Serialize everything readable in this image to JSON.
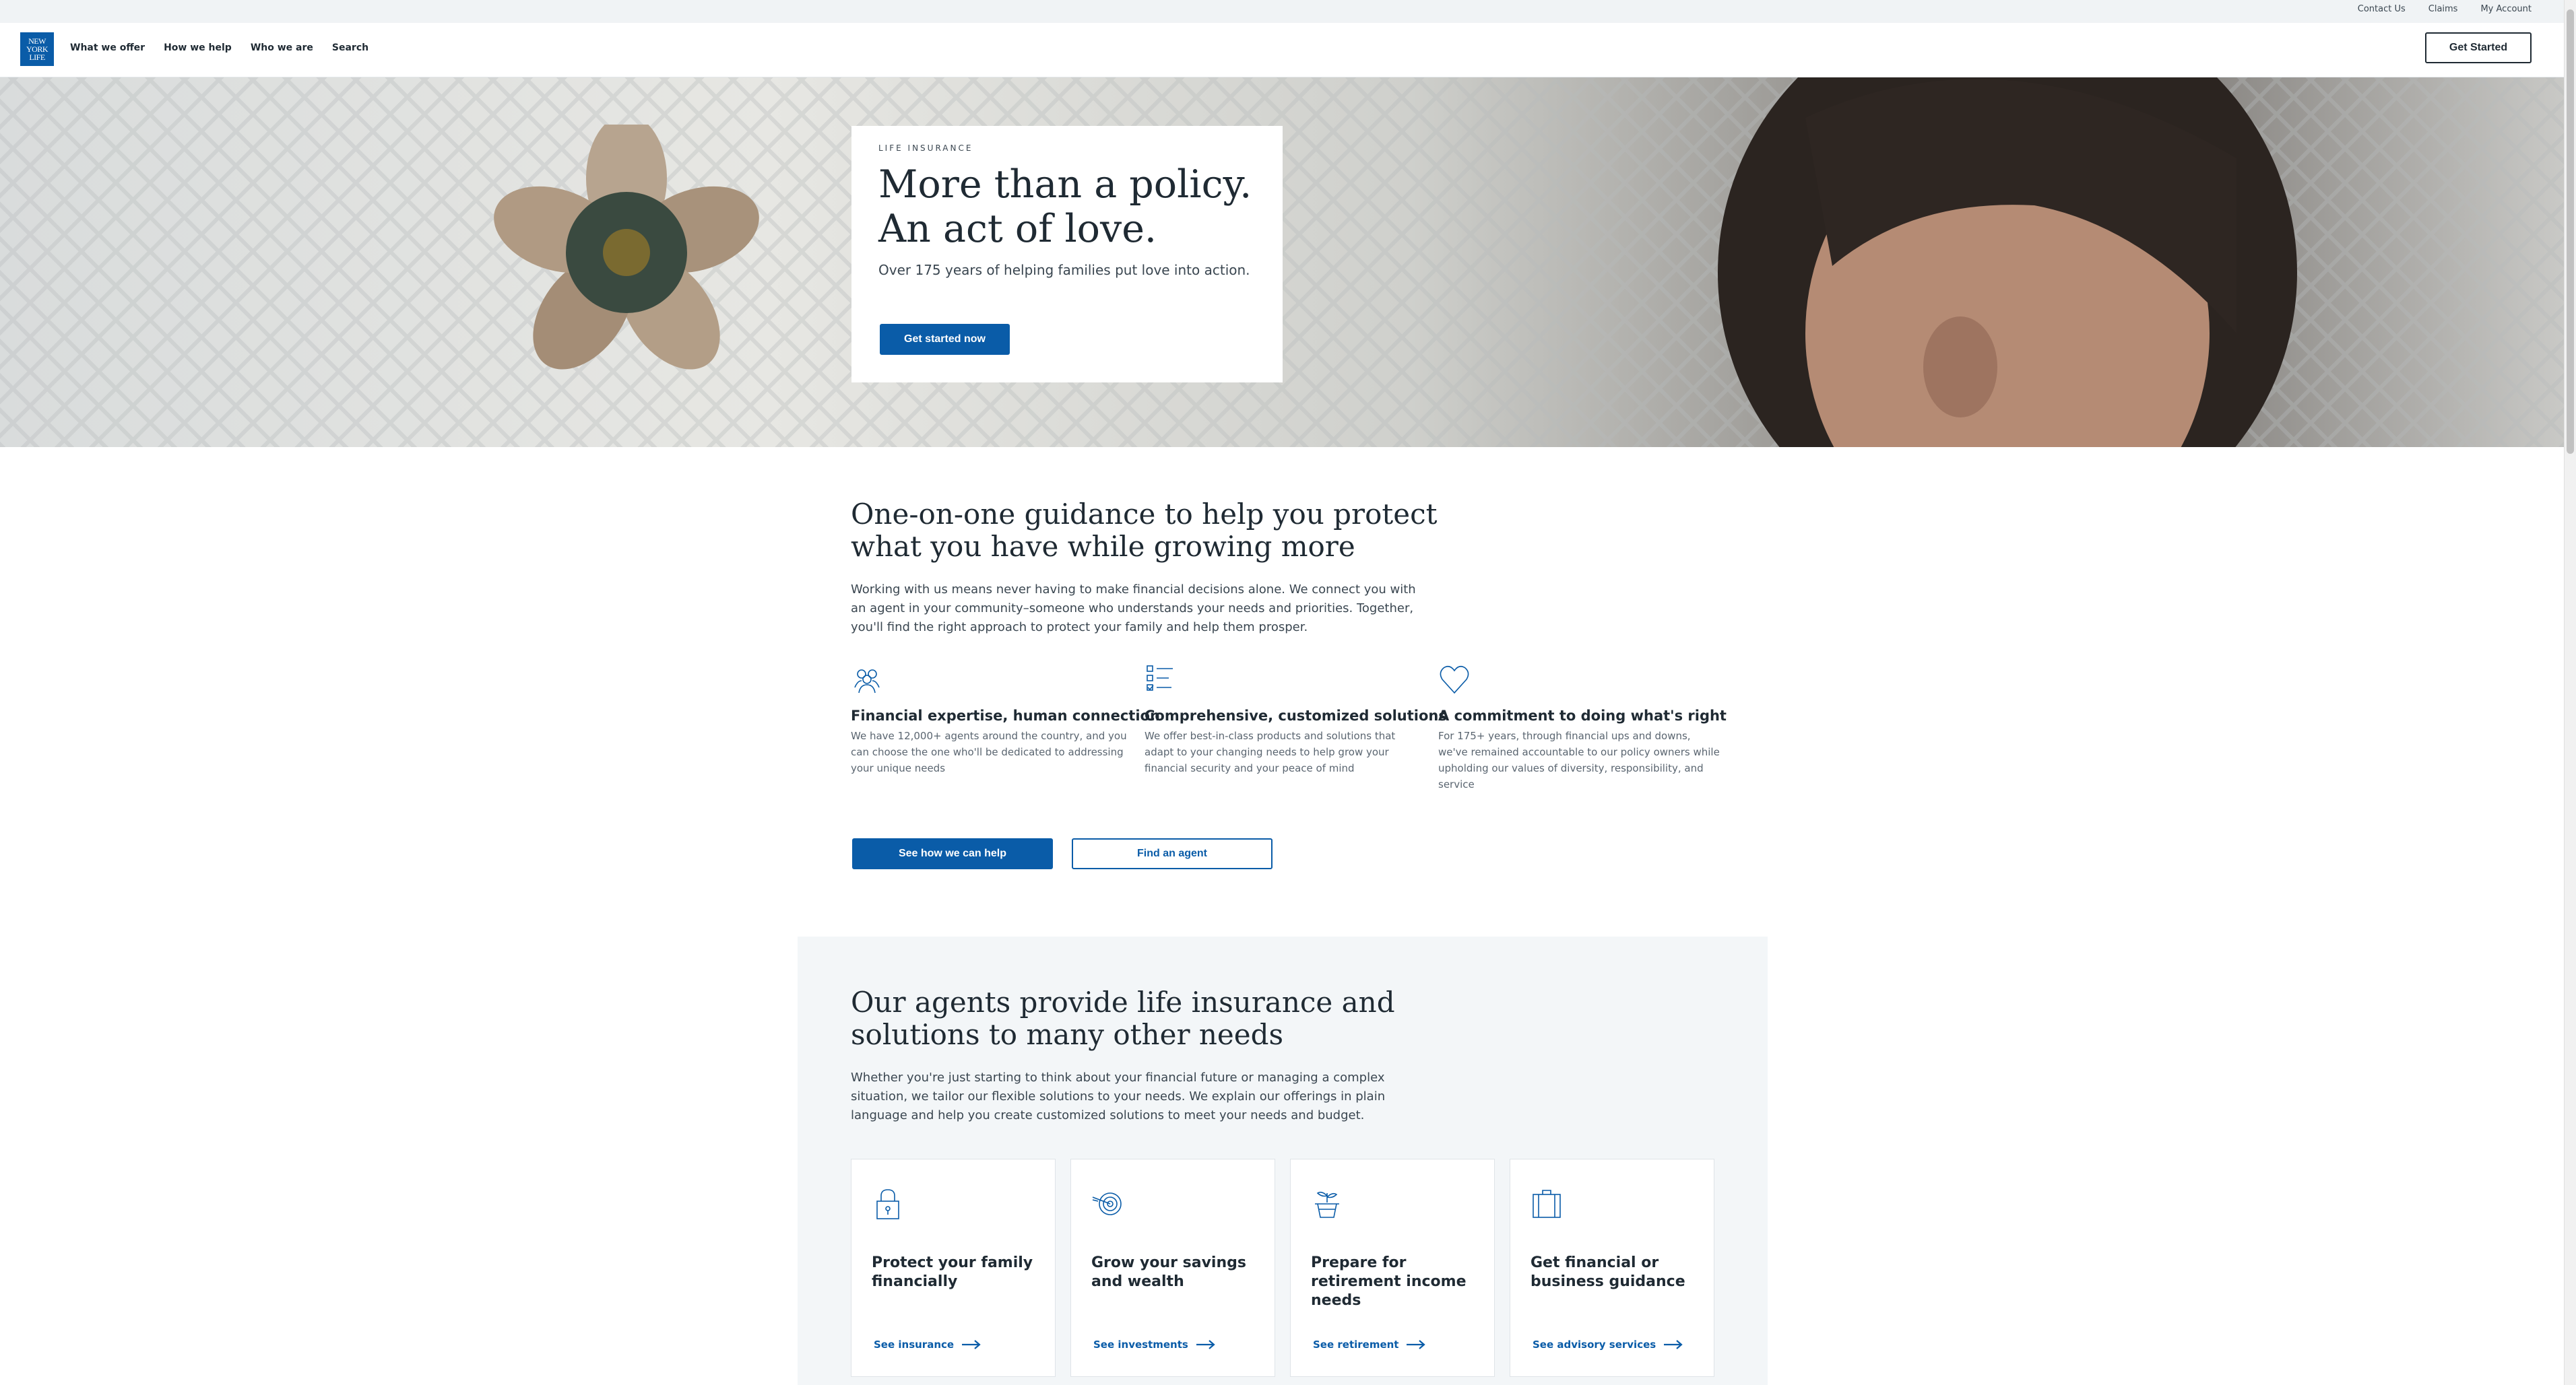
{
  "utility": {
    "links": [
      "Contact Us",
      "Claims",
      "My Account"
    ]
  },
  "header": {
    "logo_lines": [
      "NEW",
      "YORK",
      "LIFE"
    ],
    "nav": [
      "What we offer",
      "How we help",
      "Who we are",
      "Search"
    ],
    "get_started": "Get Started"
  },
  "hero": {
    "eyebrow": "LIFE INSURANCE",
    "title_line1": "More than a policy.",
    "title_line2": "An act of love.",
    "subtitle": "Over 175 years of helping families put love into action.",
    "button": "Get started now"
  },
  "guidance": {
    "heading_line1": "One-on-one guidance to help you protect",
    "heading_line2": "what you have while growing more",
    "paragraph": "Working with us means never having to make financial decisions alone. We connect you with an agent in your community–someone who understands your needs and priorities. Together, you'll find the right approach to protect your family and help them prosper.",
    "features": [
      {
        "icon": "people-group-icon",
        "title": "Financial expertise, human connection",
        "text": "We have 12,000+ agents around the country, and you can choose the one who'll be dedicated to addressing your unique needs"
      },
      {
        "icon": "checklist-icon",
        "title": "Comprehensive, customized solutions",
        "text": "We offer best-in-class products and solutions that adapt to your changing needs to help grow your financial security and your peace of mind"
      },
      {
        "icon": "heart-icon",
        "title": "A commitment to doing what's right",
        "text": "For 175+ years, through financial ups and downs, we've remained accountable to our policy owners while upholding our values of diversity, responsibility, and service"
      }
    ],
    "primary_cta": "See how we can help",
    "secondary_cta": "Find an agent"
  },
  "agents": {
    "heading_line1": "Our agents provide life insurance and",
    "heading_line2": "solutions to many other needs",
    "paragraph": "Whether you're just starting to think about your financial future or managing a complex situation, we tailor our flexible solutions to your needs. We explain our offerings in plain language and help you create customized solutions to meet your needs and budget.",
    "cards": [
      {
        "icon": "lock-icon",
        "title": "Protect your family financially",
        "link": "See insurance"
      },
      {
        "icon": "target-icon",
        "title": "Grow your savings and wealth",
        "link": "See investments"
      },
      {
        "icon": "plant-pot-icon",
        "title": "Prepare for retirement income needs",
        "link": "See retirement"
      },
      {
        "icon": "briefcase-icon",
        "title": "Get financial or business guidance",
        "link": "See advisory services"
      }
    ]
  },
  "colors": {
    "brand_blue": "#0a5ca8",
    "text_dark": "#1f2a33",
    "section_bg": "#f3f6f8"
  }
}
